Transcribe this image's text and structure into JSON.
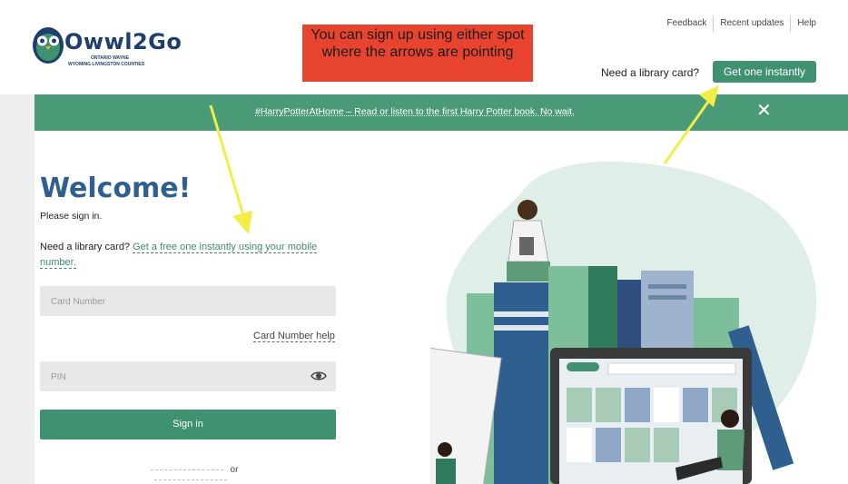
{
  "header": {
    "logo": {
      "name": "Owwl2Go",
      "line1": "ONTARIO   WAYNE",
      "line2": "WYOMING   LIVINGSTON   COUNTIES"
    },
    "note": "You can sign up using either spot where the arrows are pointing",
    "links": [
      "Feedback",
      "Recent updates",
      "Help"
    ],
    "need_card": "Need a library card?",
    "get_button": "Get one instantly"
  },
  "banner": {
    "text": "#HarryPotterAtHome – Read or listen to the first Harry Potter book. No wait.",
    "close": "✕"
  },
  "main": {
    "title": "Welcome!",
    "subtitle": "Please sign in.",
    "need_card_prefix": "Need a library card?",
    "need_card_link": "Get a free one instantly using your mobile number.",
    "card_placeholder": "Card Number",
    "card_help": "Card Number help",
    "pin_placeholder": "PIN",
    "sign_in": "Sign in",
    "or": "or"
  },
  "colors": {
    "accent": "#3f9170",
    "banner": "#4a9a78",
    "title": "#2f5f8f",
    "note": "#e8432e",
    "arrow": "#f2ee48"
  }
}
